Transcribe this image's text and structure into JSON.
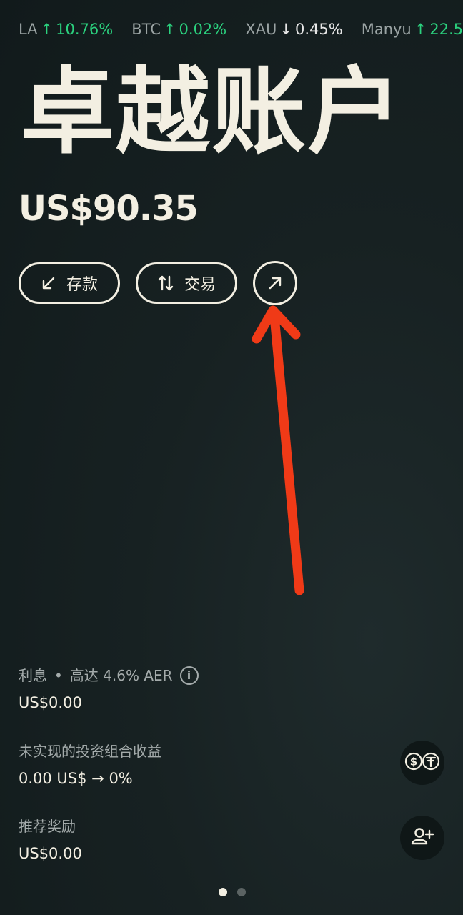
{
  "ticker": [
    {
      "symbol": "LA",
      "direction": "up",
      "arrow": "↑",
      "change": "10.76%"
    },
    {
      "symbol": "BTC",
      "direction": "up",
      "arrow": "↑",
      "change": "0.02%"
    },
    {
      "symbol": "XAU",
      "direction": "down",
      "arrow": "↓",
      "change": "0.45%"
    },
    {
      "symbol": "Manyu",
      "direction": "up",
      "arrow": "↑",
      "change": "22.5"
    }
  ],
  "account": {
    "title": "卓越账户",
    "balance": "US$90.35"
  },
  "actions": {
    "deposit_label": "存款",
    "trade_label": "交易"
  },
  "interest": {
    "label": "利息",
    "separator": "•",
    "rate": "高达 4.6% AER",
    "value": "US$0.00"
  },
  "unrealized": {
    "label": "未实现的投资组合收益",
    "value": "0.00 US$ → 0%"
  },
  "referral": {
    "label": "推荐奖励",
    "value": "US$0.00"
  },
  "pager": {
    "count": 2,
    "active": 0
  },
  "colors": {
    "accent": "#f3efe2",
    "up": "#2bd17e",
    "annotation": "#f03a17",
    "background": "#172122"
  },
  "icons": {
    "deposit": "arrow-down-left-icon",
    "trade": "swap-vertical-icon",
    "withdraw": "arrow-up-right-icon",
    "info": "info-icon",
    "currency": "dollar-tether-icon",
    "invite": "add-user-icon"
  }
}
